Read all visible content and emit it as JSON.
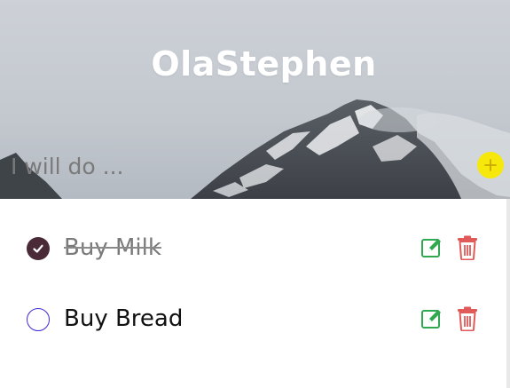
{
  "header": {
    "title": "OlaStephen",
    "input_placeholder": "I will do ...",
    "input_value": "",
    "add_icon": "plus-icon",
    "add_color": "#f5e80a"
  },
  "todos": [
    {
      "text": "Buy Milk",
      "completed": true,
      "check_icon": "checkmark-icon",
      "edit_icon": "edit-icon",
      "delete_icon": "trash-icon"
    },
    {
      "text": "Buy Bread",
      "completed": false,
      "check_icon": "circle-icon",
      "edit_icon": "edit-icon",
      "delete_icon": "trash-icon"
    }
  ],
  "colors": {
    "edit": "#2fa84f",
    "delete": "#e05a5a",
    "done_check": "#4a2a36",
    "open_check": "#3d2bd6"
  }
}
